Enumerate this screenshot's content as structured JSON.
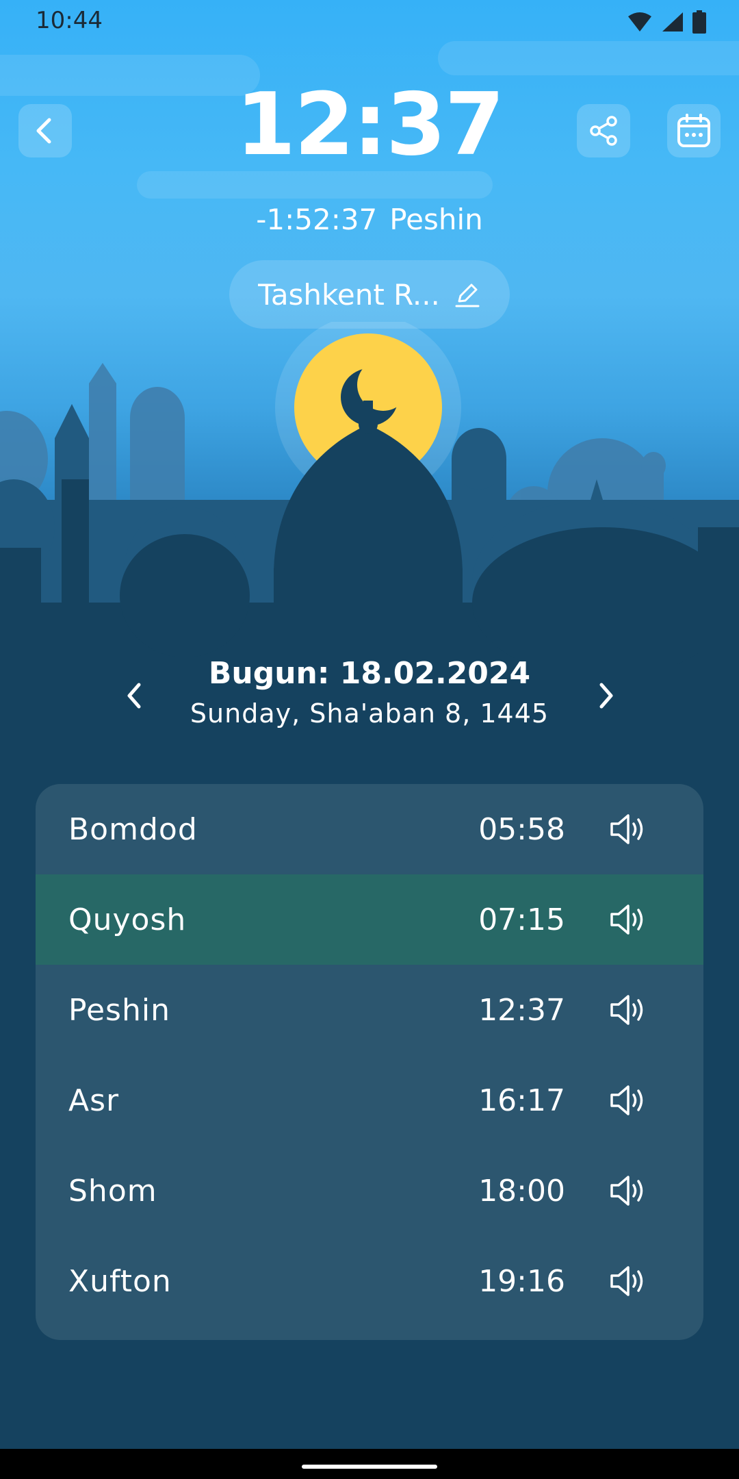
{
  "status_bar": {
    "time": "10:44"
  },
  "header": {
    "current_time": "12:37",
    "countdown": "-1:52:37",
    "next_prayer": "Peshin",
    "location": "Tashkent R..."
  },
  "date": {
    "main": "Bugun: 18.02.2024",
    "sub": "Sunday, Sha'aban 8, 1445"
  },
  "prayers": [
    {
      "name": "Bomdod",
      "time": "05:58"
    },
    {
      "name": "Quyosh",
      "time": "07:15"
    },
    {
      "name": "Peshin",
      "time": "12:37"
    },
    {
      "name": "Asr",
      "time": "16:17"
    },
    {
      "name": "Shom",
      "time": "18:00"
    },
    {
      "name": "Xufton",
      "time": "19:16"
    }
  ],
  "colors": {
    "sky_top": "#36b1f7",
    "background": "#15425f",
    "card": "#2c566f",
    "active_row": "#276866",
    "sun": "#fdd24a"
  }
}
